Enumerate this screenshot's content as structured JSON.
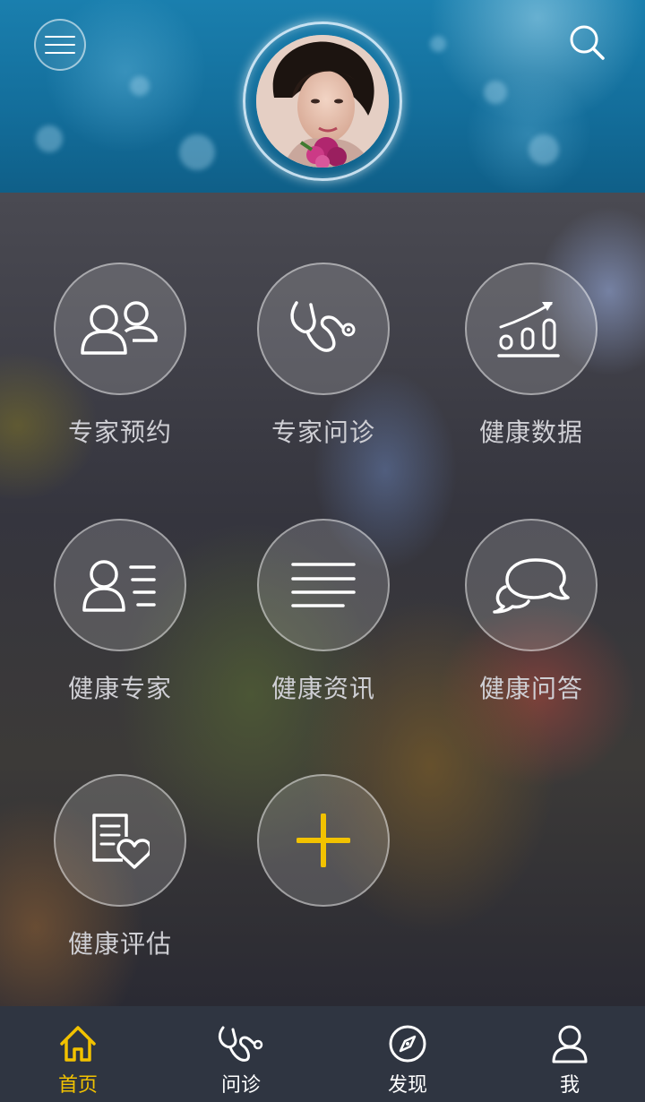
{
  "header": {
    "menu_icon": "hamburger-menu-icon",
    "search_icon": "search-icon",
    "avatar": "user-avatar-photo"
  },
  "grid": {
    "items": [
      {
        "label": "专家预约",
        "icon": "users-icon"
      },
      {
        "label": "专家问诊",
        "icon": "stethoscope-icon"
      },
      {
        "label": "健康数据",
        "icon": "chart-trend-icon"
      },
      {
        "label": "健康专家",
        "icon": "user-list-icon"
      },
      {
        "label": "健康资讯",
        "icon": "lines-icon"
      },
      {
        "label": "健康问答",
        "icon": "chat-bubbles-icon"
      },
      {
        "label": "健康评估",
        "icon": "document-heart-icon"
      },
      {
        "label": "",
        "icon": "plus-icon"
      }
    ]
  },
  "tabbar": {
    "tabs": [
      {
        "label": "首页",
        "icon": "home-icon"
      },
      {
        "label": "问诊",
        "icon": "stethoscope-icon"
      },
      {
        "label": "发现",
        "icon": "compass-icon"
      },
      {
        "label": "我",
        "icon": "person-icon"
      }
    ]
  },
  "colors": {
    "accent": "#f2c200",
    "header_blue": "#1a7fae",
    "tabbar_bg": "#2f3541"
  }
}
